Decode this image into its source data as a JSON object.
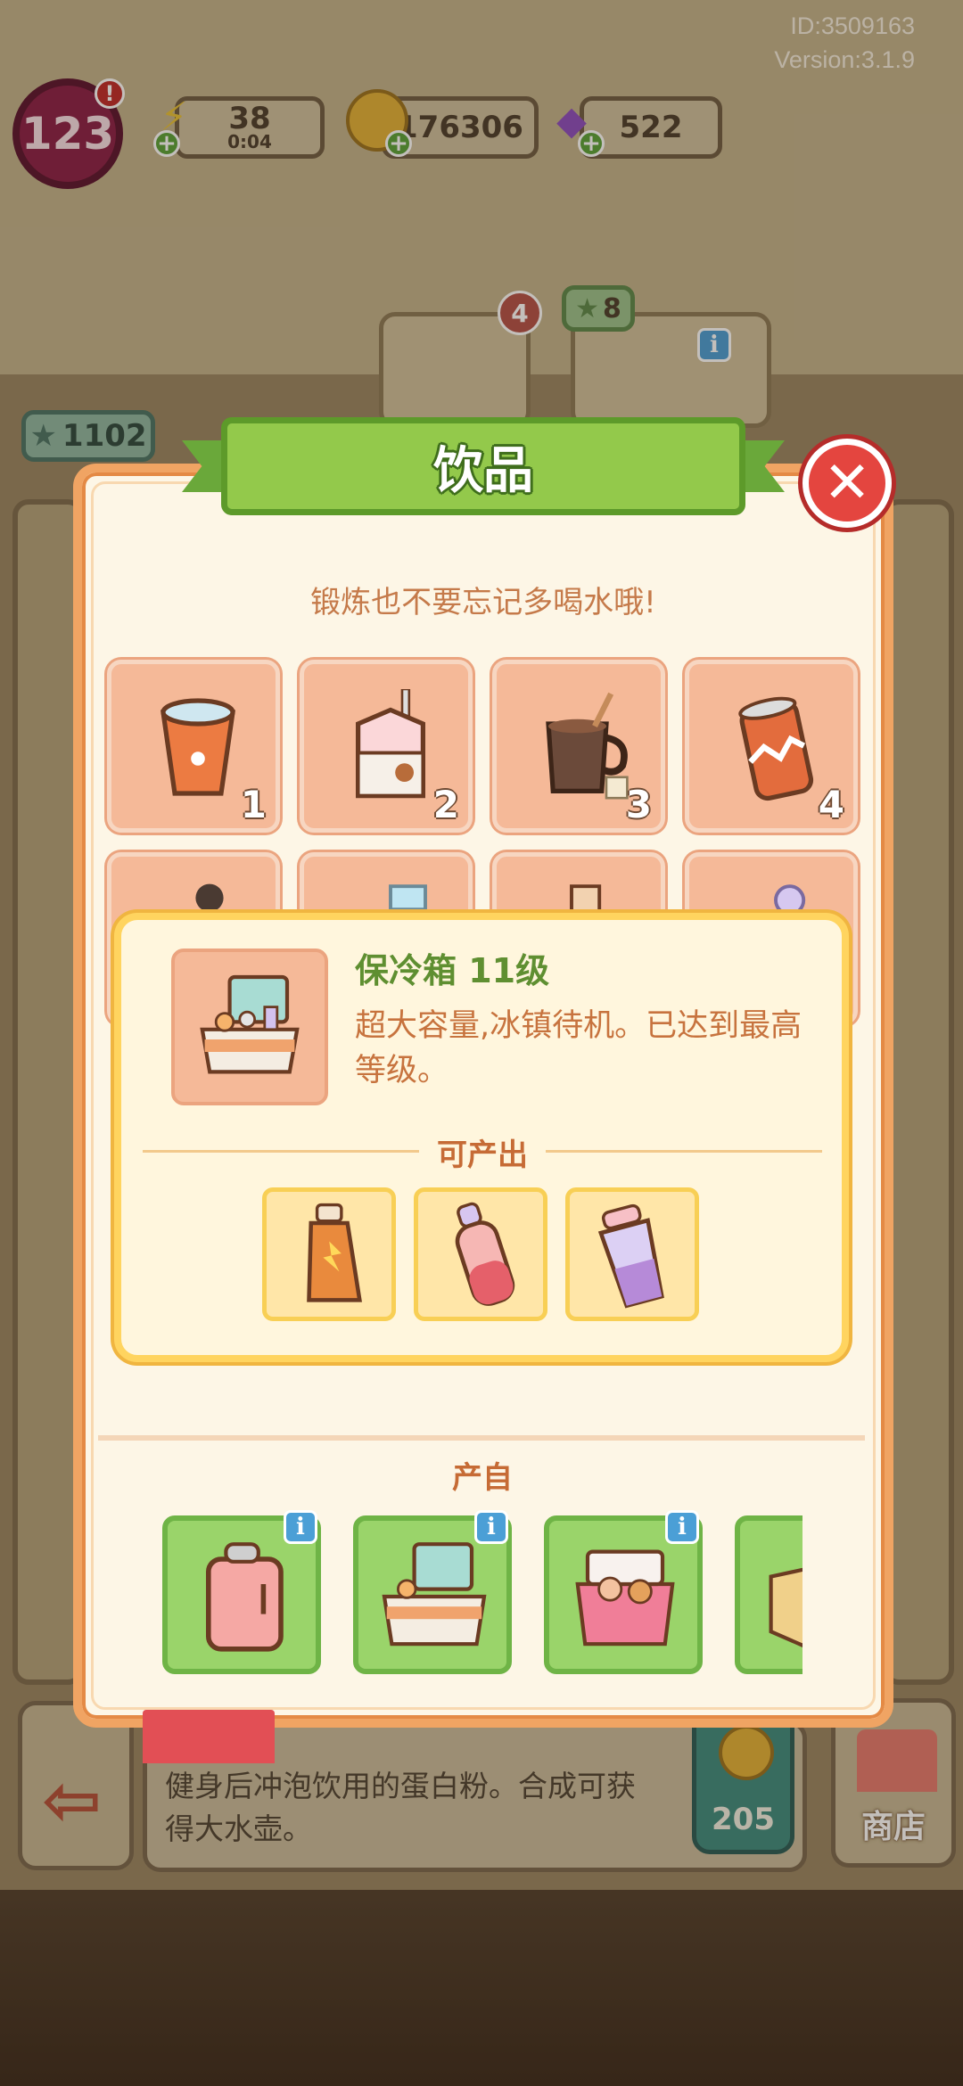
{
  "system": {
    "player_id": "ID:3509163",
    "version": "Version:3.1.9"
  },
  "hud": {
    "level": "123",
    "energy": "38",
    "energy_timer": "0:04",
    "coins": "176306",
    "gems": "522",
    "stars": "1102",
    "card_count": "4",
    "card_stars": "8"
  },
  "dialog": {
    "title": "饮品",
    "subtitle": "锻炼也不要忘记多喝水哦!",
    "grid_items": [
      {
        "number": "1",
        "icon": "paper-cup-icon"
      },
      {
        "number": "2",
        "icon": "milk-carton-icon"
      },
      {
        "number": "3",
        "icon": "coffee-mug-icon"
      },
      {
        "number": "4",
        "icon": "soda-can-icon"
      },
      {
        "number": "",
        "icon": "bottle-icon"
      },
      {
        "number": "",
        "icon": "ice-bottle-icon"
      },
      {
        "number": "",
        "icon": "juice-bottle-icon"
      },
      {
        "number": "",
        "icon": "spray-bottle-icon"
      }
    ],
    "info": {
      "title": "保冷箱 11级",
      "description": "超大容量,冰镇待机。已达到最高等级。",
      "produces_label": "可产出",
      "produces": [
        "energy-drink-icon",
        "sports-bottle-icon",
        "shaker-cup-icon"
      ]
    },
    "source_label": "产自",
    "sources": [
      "pink-fridge-icon",
      "cooler-box-icon",
      "pink-cooler-icon",
      "cardboard-box-icon"
    ]
  },
  "bottom": {
    "description": "健身后冲泡饮用的蛋白粉。合成可获得大水壶。",
    "coin_price": "205",
    "shop_label": "商店"
  },
  "colors": {
    "dialog_border": "#f0a463",
    "banner_green": "#93c94b",
    "close_red": "#e4453f",
    "cell_peach": "#f5b998",
    "source_green": "#9ad46a"
  }
}
